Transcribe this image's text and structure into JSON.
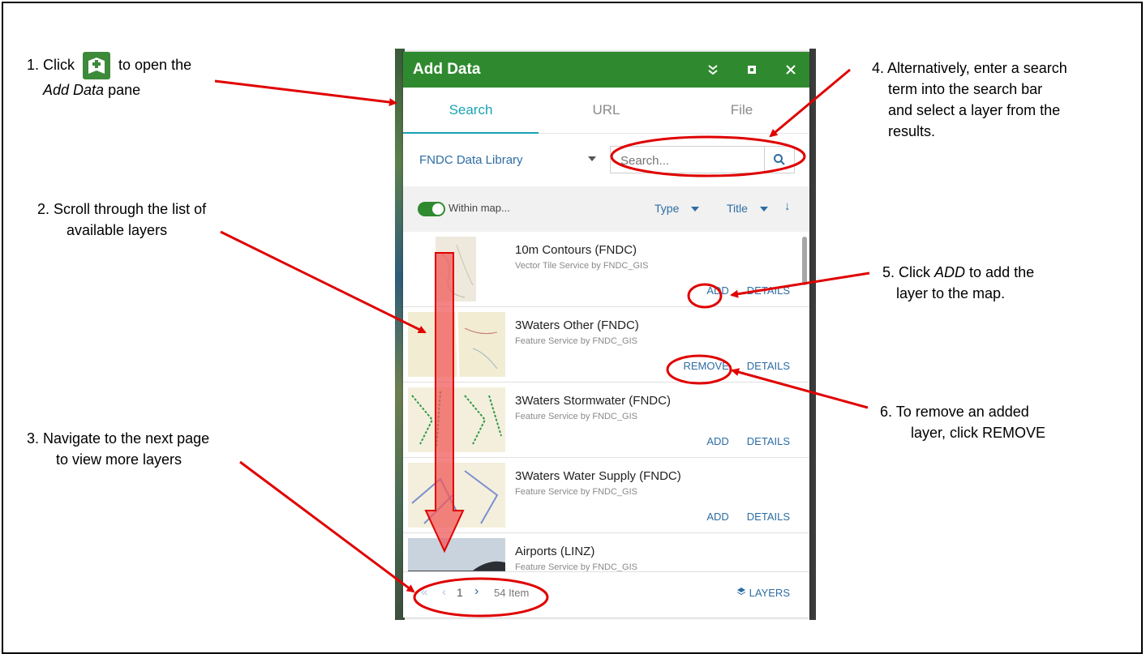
{
  "annotations": {
    "step1_prefix": "1. Click",
    "step1_suffix": "to open the",
    "step1_line2_em": "Add Data",
    "step1_line2_rest": " pane",
    "step2_line1": "2.  Scroll through the list of",
    "step2_line2": "available layers",
    "step3_line1": "3.  Navigate to the next page",
    "step3_line2": "to view more layers",
    "step4_line1": "4.  Alternatively, enter a search",
    "step4_line2": "term into the search bar",
    "step4_line3": "and select a layer from the",
    "step4_line4": "results.",
    "step5_prefix": "5. Click ",
    "step5_em": "ADD",
    "step5_suffix": " to add the",
    "step5_line2": "layer to the map.",
    "step6_line1": "6.  To remove an added",
    "step6_line2": "layer, click REMOVE"
  },
  "panel": {
    "title": "Add Data",
    "tabs": [
      {
        "label": "Search",
        "active": true
      },
      {
        "label": "URL",
        "active": false
      },
      {
        "label": "File",
        "active": false
      }
    ],
    "source_label": "FNDC Data Library",
    "search_placeholder": "Search...",
    "filter": {
      "within_map": "Within map...",
      "type_label": "Type",
      "title_label": "Title"
    },
    "items": [
      {
        "title": "10m Contours (FNDC)",
        "subtitle": "Vector Tile Service by FNDC_GIS",
        "action": "ADD",
        "details": "DETAILS"
      },
      {
        "title": "3Waters Other (FNDC)",
        "subtitle": "Feature Service by FNDC_GIS",
        "action": "REMOVE",
        "details": "DETAILS"
      },
      {
        "title": "3Waters Stormwater (FNDC)",
        "subtitle": "Feature Service by FNDC_GIS",
        "action": "ADD",
        "details": "DETAILS"
      },
      {
        "title": "3Waters Water Supply (FNDC)",
        "subtitle": "Feature Service by FNDC_GIS",
        "action": "ADD",
        "details": "DETAILS"
      },
      {
        "title": "Airports (LINZ)",
        "subtitle": "Feature Service by FNDC_GIS",
        "action": "",
        "details": ""
      }
    ],
    "pager": {
      "page": "1",
      "count": "54 Item"
    },
    "layers_label": "LAYERS"
  },
  "colors": {
    "header_green": "#2f8a2f",
    "accent_teal": "#1aa3b5",
    "link_blue": "#2d6da3",
    "annotation_red": "#e00000"
  }
}
